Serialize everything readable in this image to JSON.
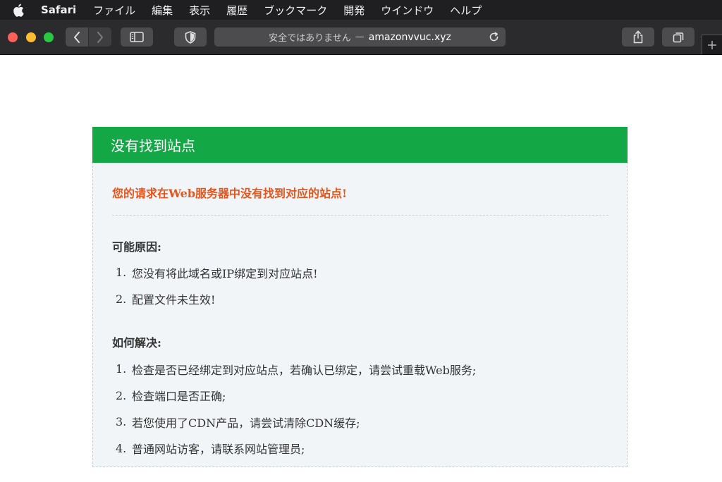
{
  "menubar": {
    "app": "Safari",
    "items": [
      "ファイル",
      "編集",
      "表示",
      "履歴",
      "ブックマーク",
      "開発",
      "ウインドウ",
      "ヘルプ"
    ]
  },
  "toolbar": {
    "address": {
      "insecure_label": "安全ではありません",
      "separator": "—",
      "domain": "amazonvvuc.xyz"
    },
    "icons": [
      "apple-icon",
      "back-icon",
      "forward-icon",
      "sidebar-icon",
      "shield-icon",
      "reload-icon",
      "share-icon",
      "tabs-icon",
      "plus-icon"
    ]
  },
  "page": {
    "header": "没有找到站点",
    "error": "您的请求在Web服务器中没有找到对应的站点!",
    "reasons_title": "可能原因:",
    "reasons": [
      {
        "num": "1.",
        "text": "您没有将此域名或IP绑定到对应站点!"
      },
      {
        "num": "2.",
        "text": "配置文件未生效!"
      }
    ],
    "solutions_title": "如何解决:",
    "solutions": [
      {
        "num": "1.",
        "text": "检查是否已经绑定到对应站点，若确认已绑定，请尝试重载Web服务;"
      },
      {
        "num": "2.",
        "text": "检查端口是否正确;"
      },
      {
        "num": "3.",
        "text": "若您使用了CDN产品，请尝试清除CDN缓存;"
      },
      {
        "num": "4.",
        "text": "普通网站访客，请联系网站管理员;"
      }
    ]
  },
  "colors": {
    "header_green": "#13a745",
    "error_orange": "#e8541a",
    "panel_bg": "#f2f5f8"
  }
}
